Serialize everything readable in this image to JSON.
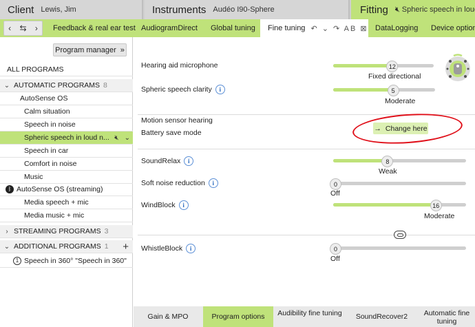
{
  "header": {
    "client_label": "Client",
    "client_name": "Lewis, Jim",
    "instruments_label": "Instruments",
    "instruments_name": "Audéo I90-Sphere",
    "fitting_label": "Fitting",
    "fitting_program": "Spheric speech in loud"
  },
  "nav": {
    "back_label": "‹",
    "swap_label": "⇆",
    "forward_label": "›",
    "tabs": [
      {
        "label": "Feedback & real ear test"
      },
      {
        "label": "AudiogramDirect"
      },
      {
        "label": "Global tuning"
      },
      {
        "label": "Fine tuning"
      },
      {
        "label": "DataLogging"
      },
      {
        "label": "Device options"
      }
    ],
    "tools": "↶ ⌄ ↷ AB ⊠"
  },
  "left": {
    "program_manager": "Program manager",
    "all_programs": "ALL PROGRAMS",
    "automatic_header": "AUTOMATIC PROGRAMS",
    "automatic_count": "8",
    "autosense": "AutoSense OS",
    "programs": [
      "Calm situation",
      "Speech in noise",
      "Spheric speech in loud n...",
      "Speech in car",
      "Comfort in noise",
      "Music"
    ],
    "autosense_streaming": "AutoSense OS (streaming)",
    "streaming_children": [
      "Media speech + mic",
      "Media music + mic"
    ],
    "streaming_header": "STREAMING PROGRAMS",
    "streaming_count": "3",
    "additional_header": "ADDITIONAL PROGRAMS",
    "additional_count": "1",
    "additional_item_num": "1",
    "additional_item": "Speech in 360° \"Speech in 360\""
  },
  "main": {
    "mic_label": "Hearing aid microphone",
    "mic_value": "12",
    "mic_text": "Fixed directional",
    "clarity_label": "Spheric speech clarity",
    "clarity_value": "5",
    "clarity_text": "Moderate",
    "motion_label": "Motion sensor hearing",
    "battery_label": "Battery save mode",
    "change_button": "Change here",
    "soundrelax_label": "SoundRelax",
    "soundrelax_value": "8",
    "soundrelax_text": "Weak",
    "snr_label": "Soft noise reduction",
    "snr_value": "0",
    "snr_text": "Off",
    "windblock_label": "WindBlock",
    "windblock_value": "16",
    "windblock_text": "Moderate",
    "whistleblock_label": "WhistleBlock",
    "whistleblock_value": "0",
    "whistleblock_text": "Off"
  },
  "sliders": {
    "mic": 0.6,
    "clarity": 0.6,
    "soundrelax": 0.4,
    "snr": 0.0,
    "windblock": 0.8,
    "whistleblock": 0.0
  },
  "bottom_tabs": [
    {
      "label": "Gain & MPO"
    },
    {
      "label": "Program options"
    },
    {
      "label": "Audibility fine tuning"
    },
    {
      "label": "SoundRecover2"
    },
    {
      "label": "Automatic fine tuning"
    }
  ],
  "colors": {
    "accent": "#bfe27a",
    "highlight_ring": "#e0101a"
  }
}
